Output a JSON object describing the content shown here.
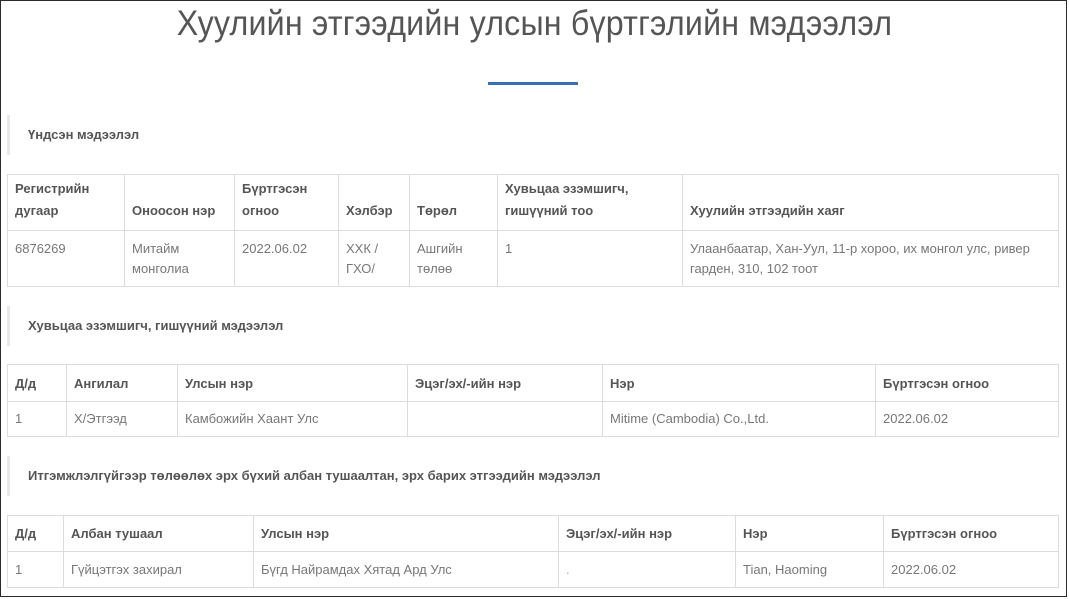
{
  "page": {
    "title": "Хуулийн этгээдийн улсын бүртгэлийн мэдээлэл",
    "accent_color": "#3a6fb5"
  },
  "basic": {
    "heading": "Үндсэн мэдээлэл",
    "columns": [
      "Регистрийн дугаар",
      "Оноосон нэр",
      "Бүртгэсэн огноо",
      "Хэлбэр",
      "Төрөл",
      "Хувьцаа эзэмшигч, гишүүний тоо",
      "Хуулийн этгээдийн хаяг"
    ],
    "rows": [
      [
        "6876269",
        "Митайм монголиа",
        "2022.06.02",
        "ХХК / ГХО/",
        "Ашгийн төлөө",
        "1",
        "Улаанбаатар, Хан-Уул, 11-р хороо, их монгол улс, ривер гарден, 310, 102 тоот"
      ]
    ]
  },
  "shareholders": {
    "heading": "Хувьцаа эзэмшигч, гишүүний мэдээлэл",
    "columns": [
      "Д/д",
      "Ангилал",
      "Улсын нэр",
      "Эцэг/эх/-ийн нэр",
      "Нэр",
      "Бүртгэсэн огноо"
    ],
    "rows": [
      [
        "1",
        "Х/Этгээд",
        "Камбожийн Хаант Улс",
        "",
        "Mitime (Cambodia) Co.,Ltd.",
        "2022.06.02"
      ]
    ]
  },
  "officials": {
    "heading": "Итгэмжлэлгүйгээр төлөөлөх эрх бүхий албан тушаалтан, эрх барих этгээдийн мэдээлэл",
    "columns": [
      "Д/д",
      "Албан тушаал",
      "Улсын нэр",
      "Эцэг/эх/-ийн нэр",
      "Нэр",
      "Бүртгэсэн огноо"
    ],
    "rows": [
      [
        "1",
        "Гүйцэтгэх захирал",
        "Бүгд Найрамдах Хятад Ард Улс",
        ".",
        "Tian, Haoming",
        "2022.06.02"
      ]
    ]
  }
}
